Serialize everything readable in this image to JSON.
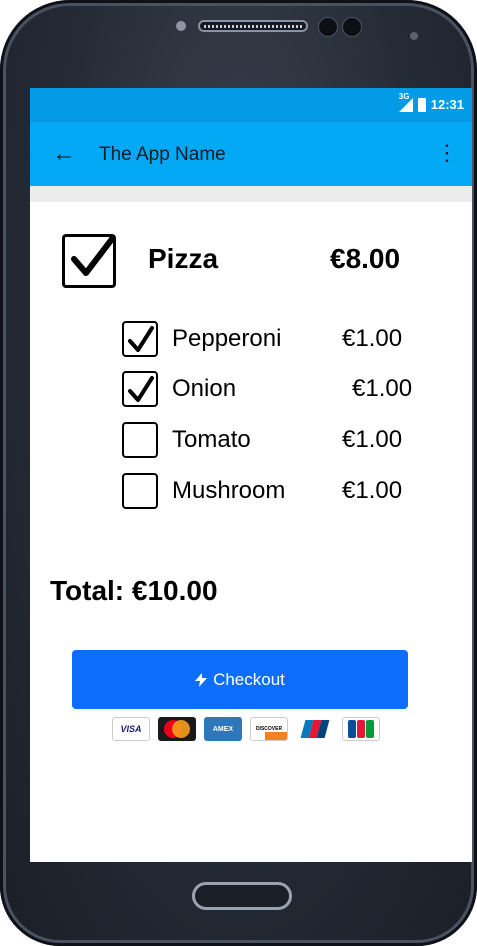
{
  "status": {
    "network": "3G",
    "time": "12:31"
  },
  "appbar": {
    "title": "The App Name",
    "back_icon": "arrow-left-icon",
    "menu_icon": "more-vert-icon"
  },
  "item": {
    "name": "Pizza",
    "price": "€8.00",
    "checked": true
  },
  "toppings": [
    {
      "name": "Pepperoni",
      "price": "€1.00",
      "checked": true
    },
    {
      "name": "Onion",
      "price": "€1.00",
      "checked": true
    },
    {
      "name": "Tomato",
      "price": "€1.00",
      "checked": false
    },
    {
      "name": "Mushroom",
      "price": "€1.00",
      "checked": false
    }
  ],
  "total": "Total: €10.00",
  "checkout": {
    "label": "Checkout",
    "icon": "lightning-icon",
    "color": "#0d6efd"
  },
  "payment_cards": [
    {
      "name": "visa-icon",
      "label": "VISA"
    },
    {
      "name": "mastercard-icon",
      "label": ""
    },
    {
      "name": "amex-icon",
      "label": "AMEX"
    },
    {
      "name": "discover-icon",
      "label": "DISCOVER"
    },
    {
      "name": "diners-icon",
      "label": ""
    },
    {
      "name": "jcb-icon",
      "label": ""
    }
  ],
  "colors": {
    "statusbar": "#039be5",
    "appbar": "#03a9f4"
  }
}
